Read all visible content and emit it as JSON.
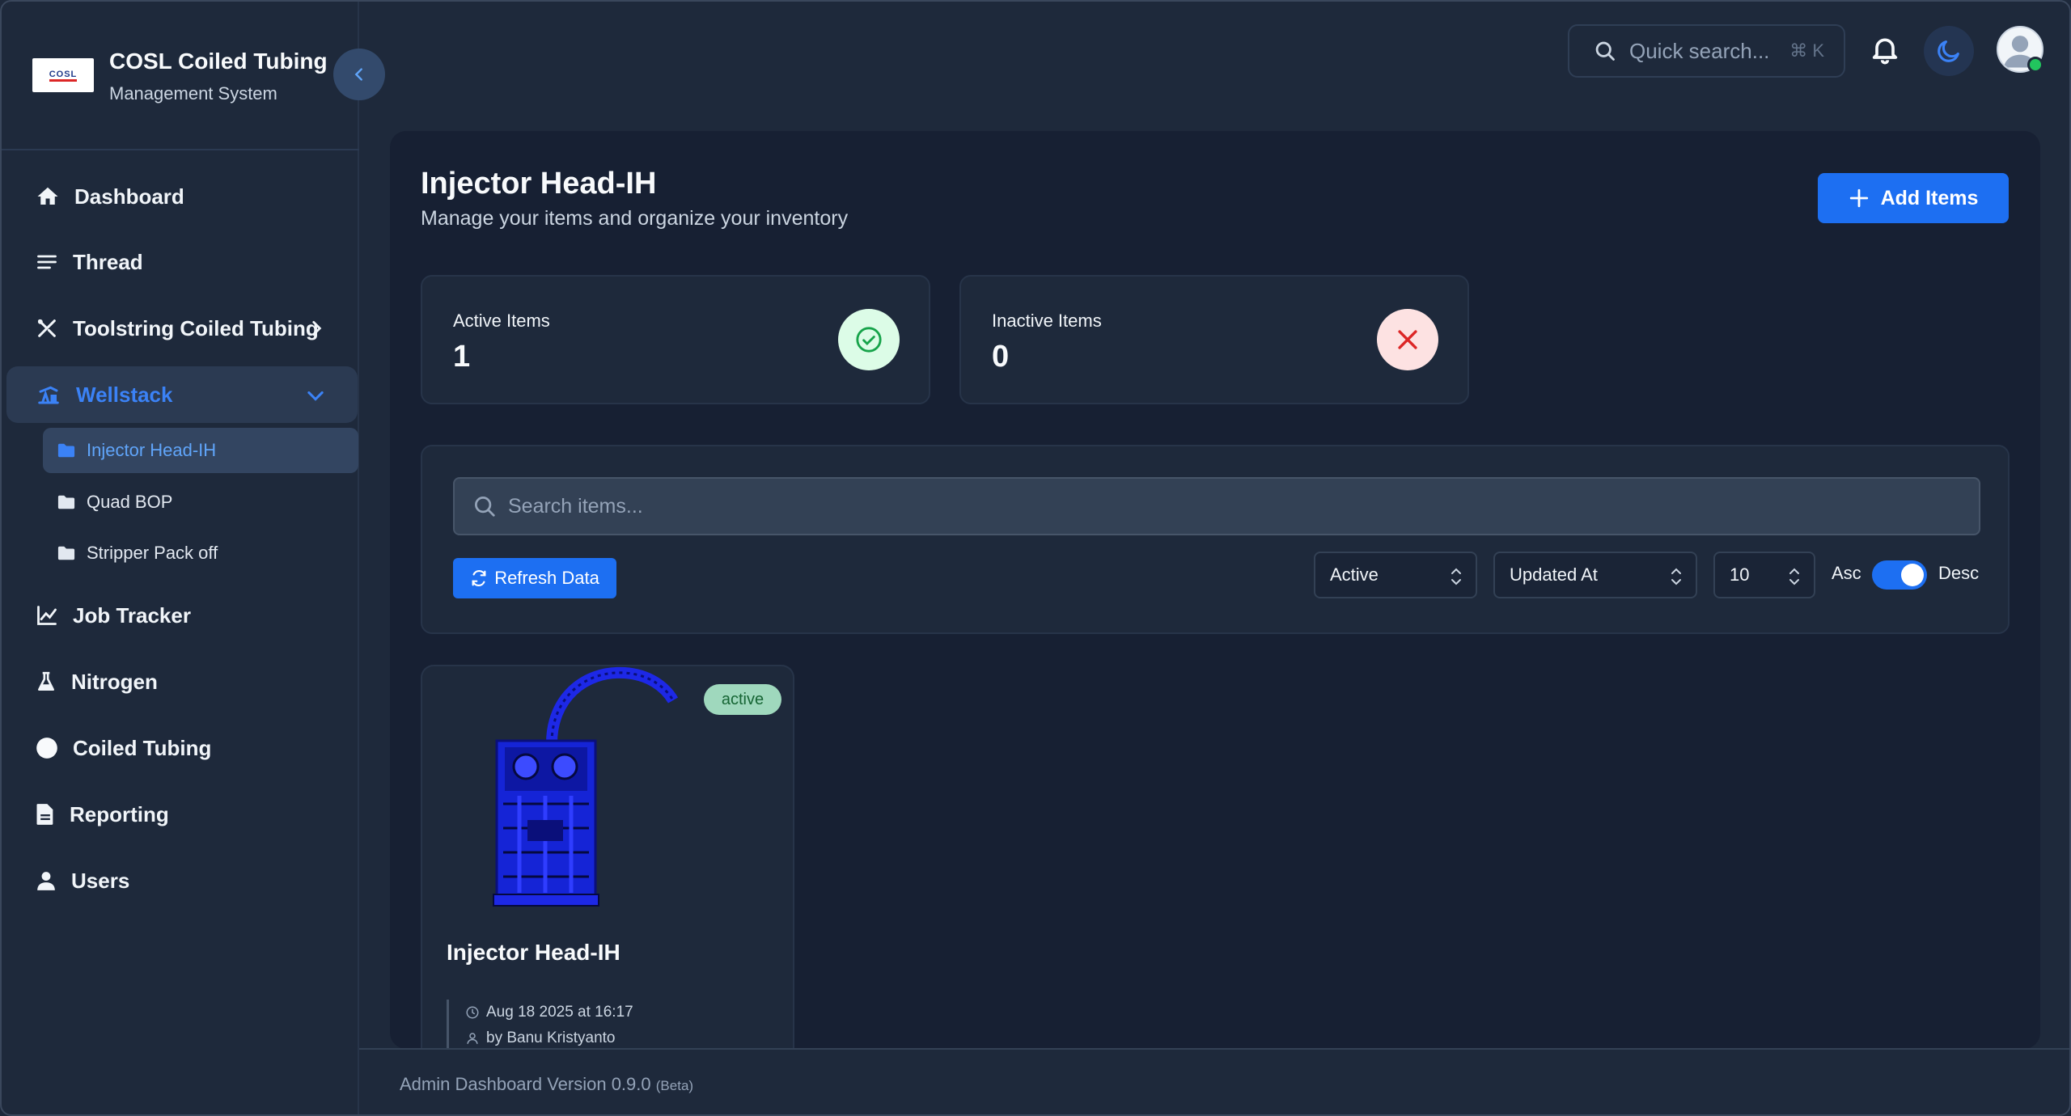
{
  "brand": {
    "title": "COSL Coiled Tubing",
    "subtitle": "Management System",
    "logo_text": "COSL"
  },
  "topbar": {
    "search_placeholder": "Quick search...",
    "search_shortcut": "⌘ K"
  },
  "sidebar": {
    "items": [
      {
        "label": "Dashboard",
        "icon": "home-icon"
      },
      {
        "label": "Thread",
        "icon": "list-icon"
      },
      {
        "label": "Toolstring Coiled Tubing",
        "icon": "tools-icon"
      },
      {
        "label": "Wellstack",
        "icon": "pumpjack-icon"
      },
      {
        "label": "Job Tracker",
        "icon": "chart-line-icon"
      },
      {
        "label": "Nitrogen",
        "icon": "flask-icon"
      },
      {
        "label": "Coiled Tubing",
        "icon": "circle-icon"
      },
      {
        "label": "Reporting",
        "icon": "file-icon"
      },
      {
        "label": "Users",
        "icon": "user-icon"
      }
    ],
    "wellstack_children": [
      {
        "label": "Injector Head-IH",
        "icon": "folder-icon"
      },
      {
        "label": "Quad BOP",
        "icon": "folder-icon"
      },
      {
        "label": "Stripper Pack off",
        "icon": "folder-icon"
      }
    ]
  },
  "page": {
    "title": "Injector Head-IH",
    "subtitle": "Manage your items and organize your inventory",
    "add_button": "Add Items"
  },
  "stats": {
    "active": {
      "label": "Active Items",
      "value": "1"
    },
    "inactive": {
      "label": "Inactive Items",
      "value": "0"
    }
  },
  "filters": {
    "search_placeholder": "Search items...",
    "refresh_label": "Refresh Data",
    "status_value": "Active",
    "sort_value": "Updated At",
    "page_size_value": "10",
    "asc_label": "Asc",
    "desc_label": "Desc"
  },
  "items": [
    {
      "title": "Injector Head-IH",
      "status": "active",
      "updated": "Aug 18 2025 at 16:17",
      "author": "by Banu Kristyanto"
    }
  ],
  "footer": {
    "version_text": "Admin Dashboard Version 0.9.0",
    "beta_text": "(Beta)"
  },
  "colors": {
    "accent": "#1d6ff2",
    "background": "#1e293b",
    "panel": "#172033",
    "success": "#22c55e",
    "danger": "#dc2626"
  }
}
